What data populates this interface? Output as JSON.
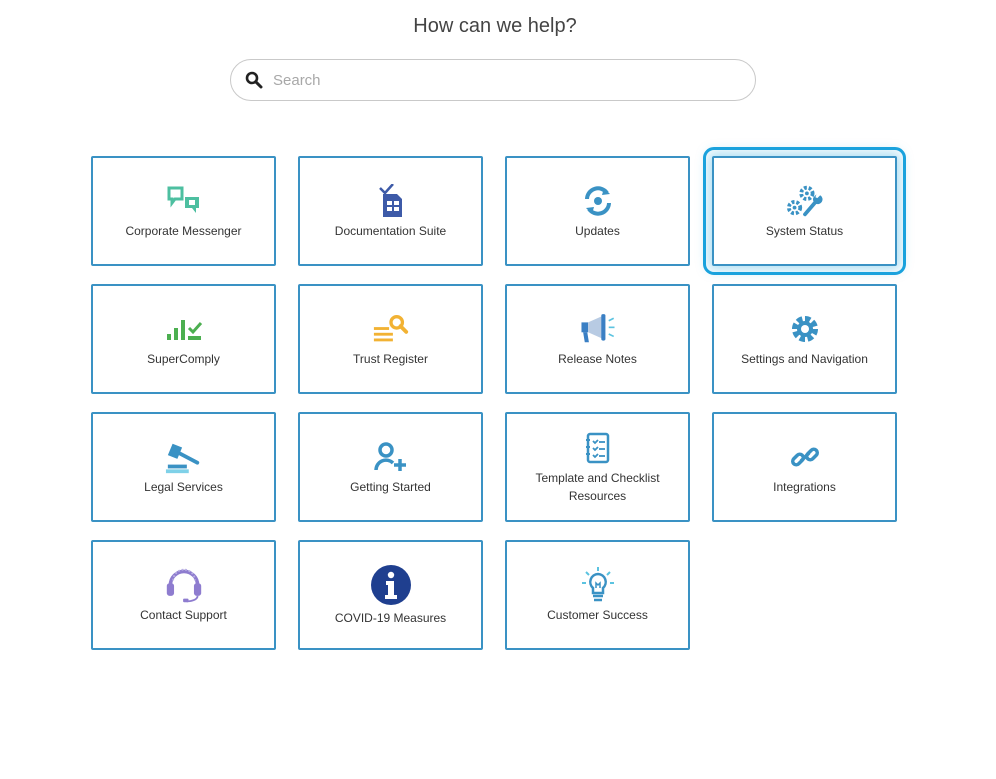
{
  "header": {
    "title": "How can we help?"
  },
  "search": {
    "placeholder": "Search",
    "value": "",
    "icon": "search-icon"
  },
  "tiles": [
    {
      "label": "Corporate Messenger",
      "icon": "chat-bubbles-icon",
      "color": "#4dbfa0"
    },
    {
      "label": "Documentation Suite",
      "icon": "document-building-icon",
      "color": "#3d5aa8"
    },
    {
      "label": "Updates",
      "icon": "refresh-icon",
      "color": "#3a92c4"
    },
    {
      "label": "System Status",
      "icon": "gears-wrench-icon",
      "color": "#3a92c4",
      "selected": true
    },
    {
      "label": "SuperComply",
      "icon": "bar-chart-check-icon",
      "color": "#4caf50"
    },
    {
      "label": "Trust Register",
      "icon": "magnifier-list-icon",
      "color": "#f2b233"
    },
    {
      "label": "Release Notes",
      "icon": "megaphone-icon",
      "color": "#3a7fc4"
    },
    {
      "label": "Settings and Navigation",
      "icon": "gear-icon",
      "color": "#3a92c4"
    },
    {
      "label": "Legal Services",
      "icon": "gavel-icon",
      "color": "#3a92c4"
    },
    {
      "label": "Getting Started",
      "icon": "add-user-icon",
      "color": "#3a92c4"
    },
    {
      "label": "Template and Checklist Resources",
      "icon": "checklist-icon",
      "color": "#3a92c4"
    },
    {
      "label": "Integrations",
      "icon": "link-icon",
      "color": "#3a92c4"
    },
    {
      "label": "Contact Support",
      "icon": "headset-icon",
      "color": "#8e7ccf"
    },
    {
      "label": "COVID-19 Measures",
      "icon": "info-icon",
      "color": "#1f3f8f"
    },
    {
      "label": "Customer Success",
      "icon": "lightbulb-icon",
      "color": "#3a92c4"
    }
  ]
}
